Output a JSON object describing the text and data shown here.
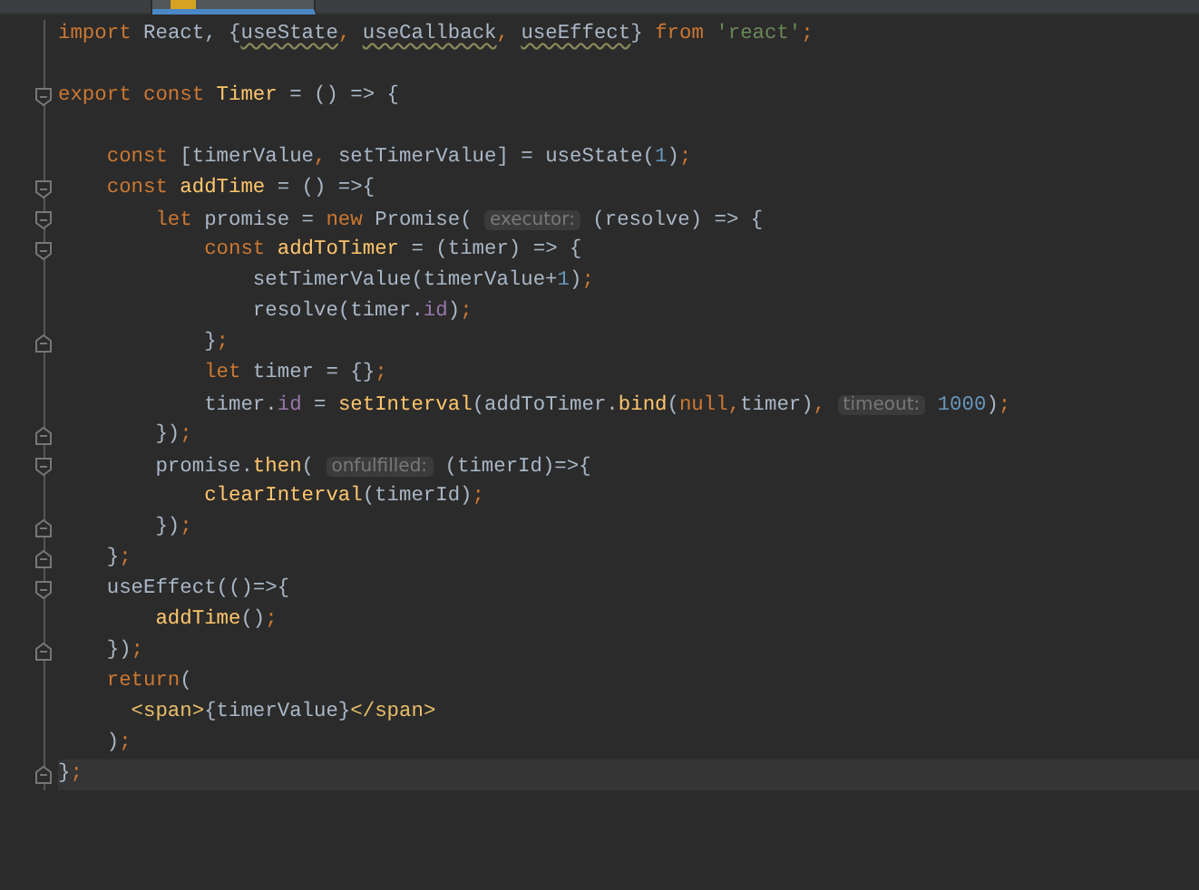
{
  "tabs": [
    {
      "selected": false
    },
    {
      "selected": true
    }
  ],
  "editor": {
    "lines": [
      {
        "tokens": [
          {
            "kind": "keyword",
            "text": "import"
          },
          {
            "kind": "plain",
            "text": " React, {"
          },
          {
            "kind": "warn",
            "text": "useState"
          },
          {
            "kind": "keyword",
            "text": ", "
          },
          {
            "kind": "warn",
            "text": "useCallback"
          },
          {
            "kind": "keyword",
            "text": ", "
          },
          {
            "kind": "warn",
            "text": "useEffect"
          },
          {
            "kind": "plain",
            "text": "} "
          },
          {
            "kind": "keyword",
            "text": "from "
          },
          {
            "kind": "string",
            "text": "'react'"
          },
          {
            "kind": "keyword",
            "text": ";"
          }
        ]
      },
      {
        "space_before": true,
        "fold_start": true,
        "tokens": [
          {
            "kind": "keyword",
            "text": "export const "
          },
          {
            "kind": "function",
            "text": "Timer"
          },
          {
            "kind": "plain",
            "text": " = () => {"
          }
        ]
      },
      {
        "space_before": true,
        "tokens": [
          {
            "kind": "keyword",
            "text": "    const"
          },
          {
            "kind": "plain",
            "text": " [timerValue"
          },
          {
            "kind": "keyword",
            "text": ","
          },
          {
            "kind": "plain",
            "text": " setTimerValue] = useState("
          },
          {
            "kind": "number",
            "text": "1"
          },
          {
            "kind": "plain",
            "text": ")"
          },
          {
            "kind": "keyword",
            "text": ";"
          }
        ]
      },
      {
        "fold_start": true,
        "tokens": [
          {
            "kind": "keyword",
            "text": "    const "
          },
          {
            "kind": "function",
            "text": "addTime"
          },
          {
            "kind": "plain",
            "text": " = () =>{"
          }
        ]
      },
      {
        "fold_start": true,
        "tokens": [
          {
            "kind": "keyword",
            "text": "        let"
          },
          {
            "kind": "plain",
            "text": " promise = "
          },
          {
            "kind": "keyword",
            "text": "new"
          },
          {
            "kind": "plain",
            "text": " Promise( "
          },
          {
            "kind": "hint",
            "text": "executor:"
          },
          {
            "kind": "plain",
            "text": " (resolve) => {"
          }
        ]
      },
      {
        "fold_start": true,
        "tokens": [
          {
            "kind": "keyword",
            "text": "            const "
          },
          {
            "kind": "function",
            "text": "addToTimer"
          },
          {
            "kind": "plain",
            "text": " = (timer) => {"
          }
        ]
      },
      {
        "tokens": [
          {
            "kind": "plain",
            "text": "                setTimerValue(timerValue+"
          },
          {
            "kind": "number",
            "text": "1"
          },
          {
            "kind": "plain",
            "text": ")"
          },
          {
            "kind": "keyword",
            "text": ";"
          }
        ]
      },
      {
        "tokens": [
          {
            "kind": "plain",
            "text": "                resolve(timer."
          },
          {
            "kind": "member",
            "text": "id"
          },
          {
            "kind": "plain",
            "text": ")"
          },
          {
            "kind": "keyword",
            "text": ";"
          }
        ]
      },
      {
        "fold_end": true,
        "tokens": [
          {
            "kind": "plain",
            "text": "            }"
          },
          {
            "kind": "keyword",
            "text": ";"
          }
        ]
      },
      {
        "tokens": [
          {
            "kind": "keyword",
            "text": "            let"
          },
          {
            "kind": "plain",
            "text": " timer = {}"
          },
          {
            "kind": "keyword",
            "text": ";"
          }
        ]
      },
      {
        "tokens": [
          {
            "kind": "plain",
            "text": "            timer."
          },
          {
            "kind": "member",
            "text": "id"
          },
          {
            "kind": "plain",
            "text": " = "
          },
          {
            "kind": "function",
            "text": "setInterval"
          },
          {
            "kind": "plain",
            "text": "(addToTimer."
          },
          {
            "kind": "function",
            "text": "bind"
          },
          {
            "kind": "plain",
            "text": "("
          },
          {
            "kind": "keyword",
            "text": "null,"
          },
          {
            "kind": "plain",
            "text": "timer)"
          },
          {
            "kind": "keyword",
            "text": ", "
          },
          {
            "kind": "hint",
            "text": "timeout:"
          },
          {
            "kind": "number",
            "text": " 1000"
          },
          {
            "kind": "plain",
            "text": ")"
          },
          {
            "kind": "keyword",
            "text": ";"
          }
        ]
      },
      {
        "fold_end": true,
        "tokens": [
          {
            "kind": "plain",
            "text": "        })"
          },
          {
            "kind": "keyword",
            "text": ";"
          }
        ]
      },
      {
        "fold_start": true,
        "tokens": [
          {
            "kind": "plain",
            "text": "        promise."
          },
          {
            "kind": "function",
            "text": "then"
          },
          {
            "kind": "plain",
            "text": "( "
          },
          {
            "kind": "hint",
            "text": "onfulfilled:"
          },
          {
            "kind": "plain",
            "text": " (timerId)=>{"
          }
        ]
      },
      {
        "tokens": [
          {
            "kind": "function",
            "text": "            clearInterval"
          },
          {
            "kind": "plain",
            "text": "(timerId)"
          },
          {
            "kind": "keyword",
            "text": ";"
          }
        ]
      },
      {
        "fold_end": true,
        "tokens": [
          {
            "kind": "plain",
            "text": "        })"
          },
          {
            "kind": "keyword",
            "text": ";"
          }
        ]
      },
      {
        "fold_end": true,
        "tokens": [
          {
            "kind": "plain",
            "text": "    }"
          },
          {
            "kind": "keyword",
            "text": ";"
          }
        ]
      },
      {
        "fold_start": true,
        "tokens": [
          {
            "kind": "plain",
            "text": "    useEffect(()=>{"
          }
        ]
      },
      {
        "tokens": [
          {
            "kind": "function",
            "text": "        addTime"
          },
          {
            "kind": "plain",
            "text": "()"
          },
          {
            "kind": "keyword",
            "text": ";"
          }
        ]
      },
      {
        "fold_end": true,
        "tokens": [
          {
            "kind": "plain",
            "text": "    })"
          },
          {
            "kind": "keyword",
            "text": ";"
          }
        ]
      },
      {
        "tokens": [
          {
            "kind": "keyword",
            "text": "    return"
          },
          {
            "kind": "plain",
            "text": "("
          }
        ]
      },
      {
        "tokens": [
          {
            "kind": "tag",
            "text": "      <span>"
          },
          {
            "kind": "plain",
            "text": "{timerValue}"
          },
          {
            "kind": "tag",
            "text": "</span>"
          }
        ]
      },
      {
        "tokens": [
          {
            "kind": "plain",
            "text": "    )"
          },
          {
            "kind": "keyword",
            "text": ";"
          }
        ]
      },
      {
        "fold_end": true,
        "current": true,
        "tokens": [
          {
            "kind": "plain",
            "text": "}"
          },
          {
            "kind": "keyword",
            "text": ";"
          }
        ]
      }
    ]
  }
}
